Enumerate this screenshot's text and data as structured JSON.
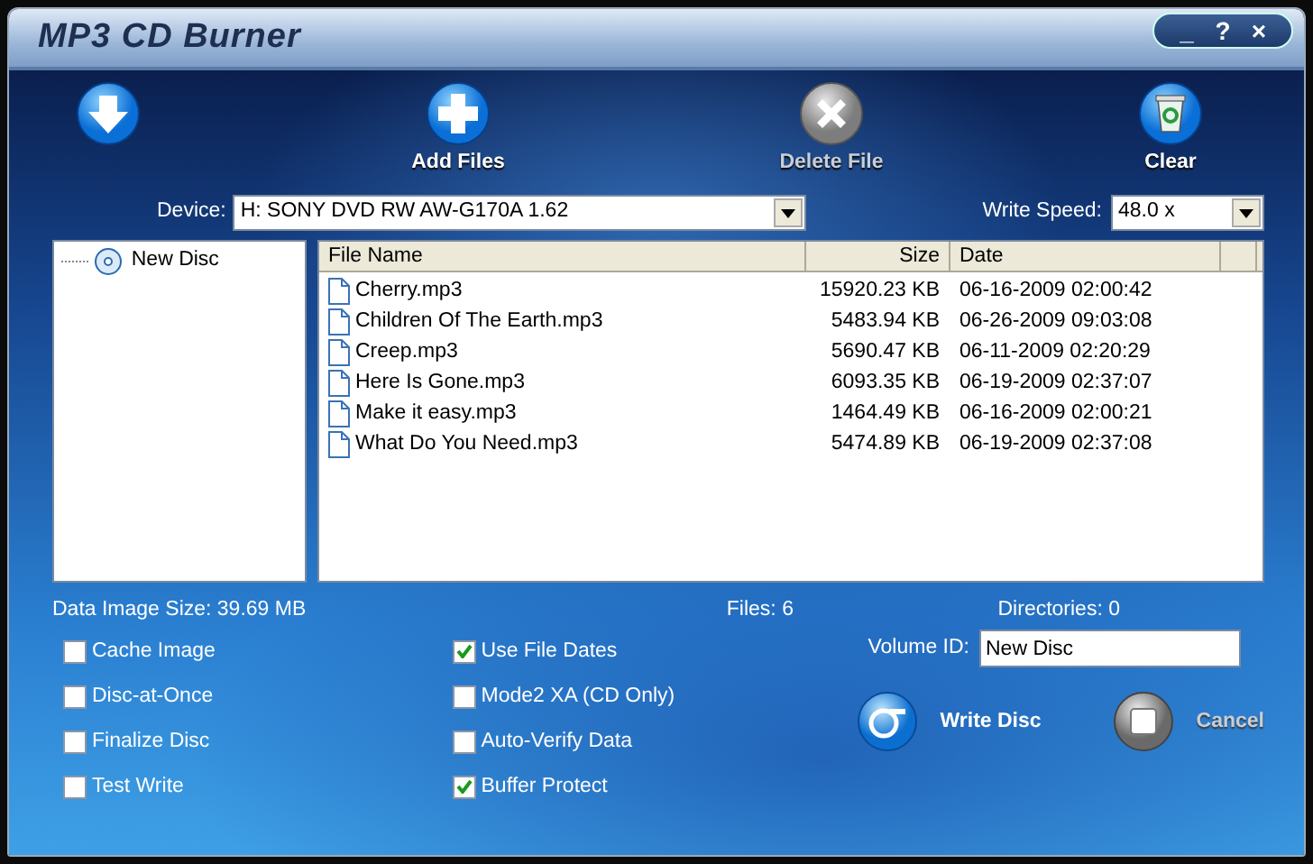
{
  "window": {
    "title": "MP3 CD Burner",
    "controls": [
      "_",
      "?",
      "×"
    ]
  },
  "toolbar": [
    {
      "kind": "download",
      "disabled": false
    },
    {
      "kind": "add",
      "label": "Add Files",
      "disabled": false
    },
    {
      "kind": "delete",
      "label": "Delete File",
      "disabled": true
    },
    {
      "kind": "clear",
      "label": "Clear",
      "disabled": false
    }
  ],
  "device": {
    "label": "Device:",
    "value": "H: SONY DVD RW AW-G170A 1.62"
  },
  "write_speed": {
    "label": "Write Speed:",
    "value": "48.0 x"
  },
  "tree": [
    {
      "label": "New Disc"
    }
  ],
  "table": {
    "columns": [
      "File Name",
      "Size",
      "Date"
    ],
    "rows": [
      [
        "Cherry.mp3",
        "15920.23 KB",
        "06-16-2009 02:00:42"
      ],
      [
        "Children Of The Earth.mp3",
        "5483.94 KB",
        "06-26-2009 09:03:08"
      ],
      [
        "Creep.mp3",
        "5690.47 KB",
        "06-11-2009 02:20:29"
      ],
      [
        "Here Is Gone.mp3",
        "6093.35 KB",
        "06-19-2009 02:37:07"
      ],
      [
        "Make it easy.mp3",
        "1464.49 KB",
        "06-16-2009 02:00:21"
      ],
      [
        "What Do You Need.mp3",
        "5474.89 KB",
        "06-19-2009 02:37:08"
      ]
    ]
  },
  "status": {
    "data_image_size": "Data Image Size: 39.69 MB",
    "files": "Files: 6",
    "directories": "Directories: 0"
  },
  "options_left": [
    {
      "label": "Cache Image",
      "checked": false
    },
    {
      "label": "Disc-at-Once",
      "checked": false
    },
    {
      "label": "Finalize Disc",
      "checked": false
    },
    {
      "label": "Test Write",
      "checked": false
    }
  ],
  "options_right": [
    {
      "label": "Use File Dates",
      "checked": true
    },
    {
      "label": "Mode2 XA (CD Only)",
      "checked": false
    },
    {
      "label": "Auto-Verify Data",
      "checked": false
    },
    {
      "label": "Buffer Protect",
      "checked": true
    }
  ],
  "volume_id": {
    "label": "Volume ID:",
    "value": "New Disc"
  },
  "actions": [
    {
      "kind": "write",
      "label": "Write Disc",
      "disabled": false
    },
    {
      "kind": "cancel",
      "label": "Cancel",
      "disabled": true
    }
  ]
}
